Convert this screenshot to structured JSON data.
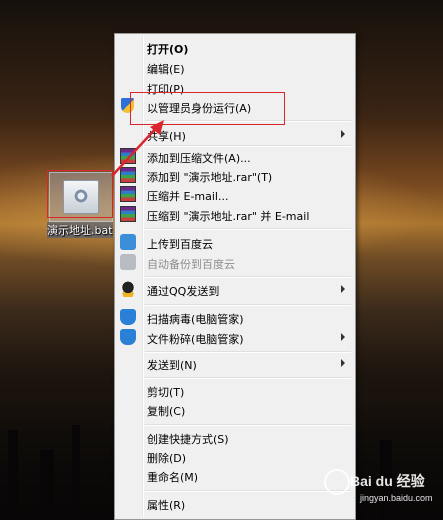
{
  "desktop": {
    "file_label": "演示地址.bat"
  },
  "menu": {
    "items": [
      {
        "label": "打开(O)",
        "bold": true
      },
      {
        "label": "编辑(E)"
      },
      {
        "label": "打印(P)"
      },
      {
        "label": "以管理员身份运行(A)",
        "icon": "uac-shield-icon"
      },
      {
        "label": "共享(H)",
        "submenu": true
      },
      {
        "label": "添加到压缩文件(A)...",
        "icon": "winrar-icon"
      },
      {
        "label": "添加到 \"演示地址.rar\"(T)",
        "icon": "winrar-icon"
      },
      {
        "label": "压缩并 E-mail...",
        "icon": "winrar-icon"
      },
      {
        "label": "压缩到 \"演示地址.rar\" 并 E-mail",
        "icon": "winrar-icon"
      },
      {
        "label": "上传到百度云",
        "icon": "baidu-cloud-icon"
      },
      {
        "label": "自动备份到百度云",
        "icon": "baidu-cloud-icon",
        "disabled": true
      },
      {
        "label": "通过QQ发送到",
        "icon": "qq-icon",
        "submenu": true
      },
      {
        "label": "扫描病毒(电脑管家)",
        "icon": "pc-manager-icon"
      },
      {
        "label": "文件粉碎(电脑管家)",
        "icon": "pc-manager-icon",
        "submenu": true
      },
      {
        "label": "发送到(N)",
        "submenu": true
      },
      {
        "label": "剪切(T)"
      },
      {
        "label": "复制(C)"
      },
      {
        "label": "创建快捷方式(S)"
      },
      {
        "label": "删除(D)"
      },
      {
        "label": "重命名(M)"
      },
      {
        "label": "属性(R)"
      }
    ]
  },
  "watermark": {
    "brand": "Bai du 经验",
    "url": "jingyan.baidu.com"
  },
  "colors": {
    "highlight_box": "#d8262c",
    "menu_bg": "#f0f0f0"
  }
}
